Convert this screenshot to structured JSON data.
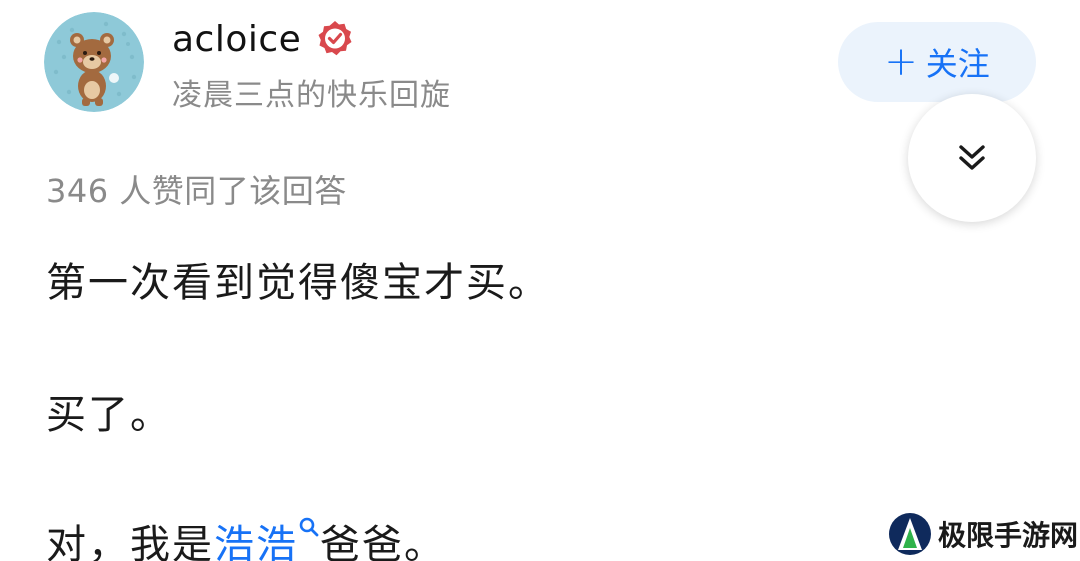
{
  "author": {
    "name": "acloice",
    "bio": "凌晨三点的快乐回旋",
    "avatar_icon": "bear-avatar-icon",
    "verified_icon": "verified-badge-icon"
  },
  "follow_button": {
    "plus": "+",
    "label": "关注"
  },
  "collapse_button": {
    "icon": "double-chevron-down-icon"
  },
  "votes": {
    "text": "346 人赞同了该回答"
  },
  "answer": {
    "p1": "第一次看到觉得傻宝才买。",
    "p2": "买了。",
    "p3_before": "对，我是",
    "p3_link": "浩浩",
    "p3_after": "爸爸。"
  },
  "watermark": {
    "text": "极限手游网"
  },
  "colors": {
    "accent": "#1772f6",
    "follow_bg": "#ebf3fc",
    "muted_text": "#8a8a8a",
    "verified_red": "#d9484d"
  }
}
